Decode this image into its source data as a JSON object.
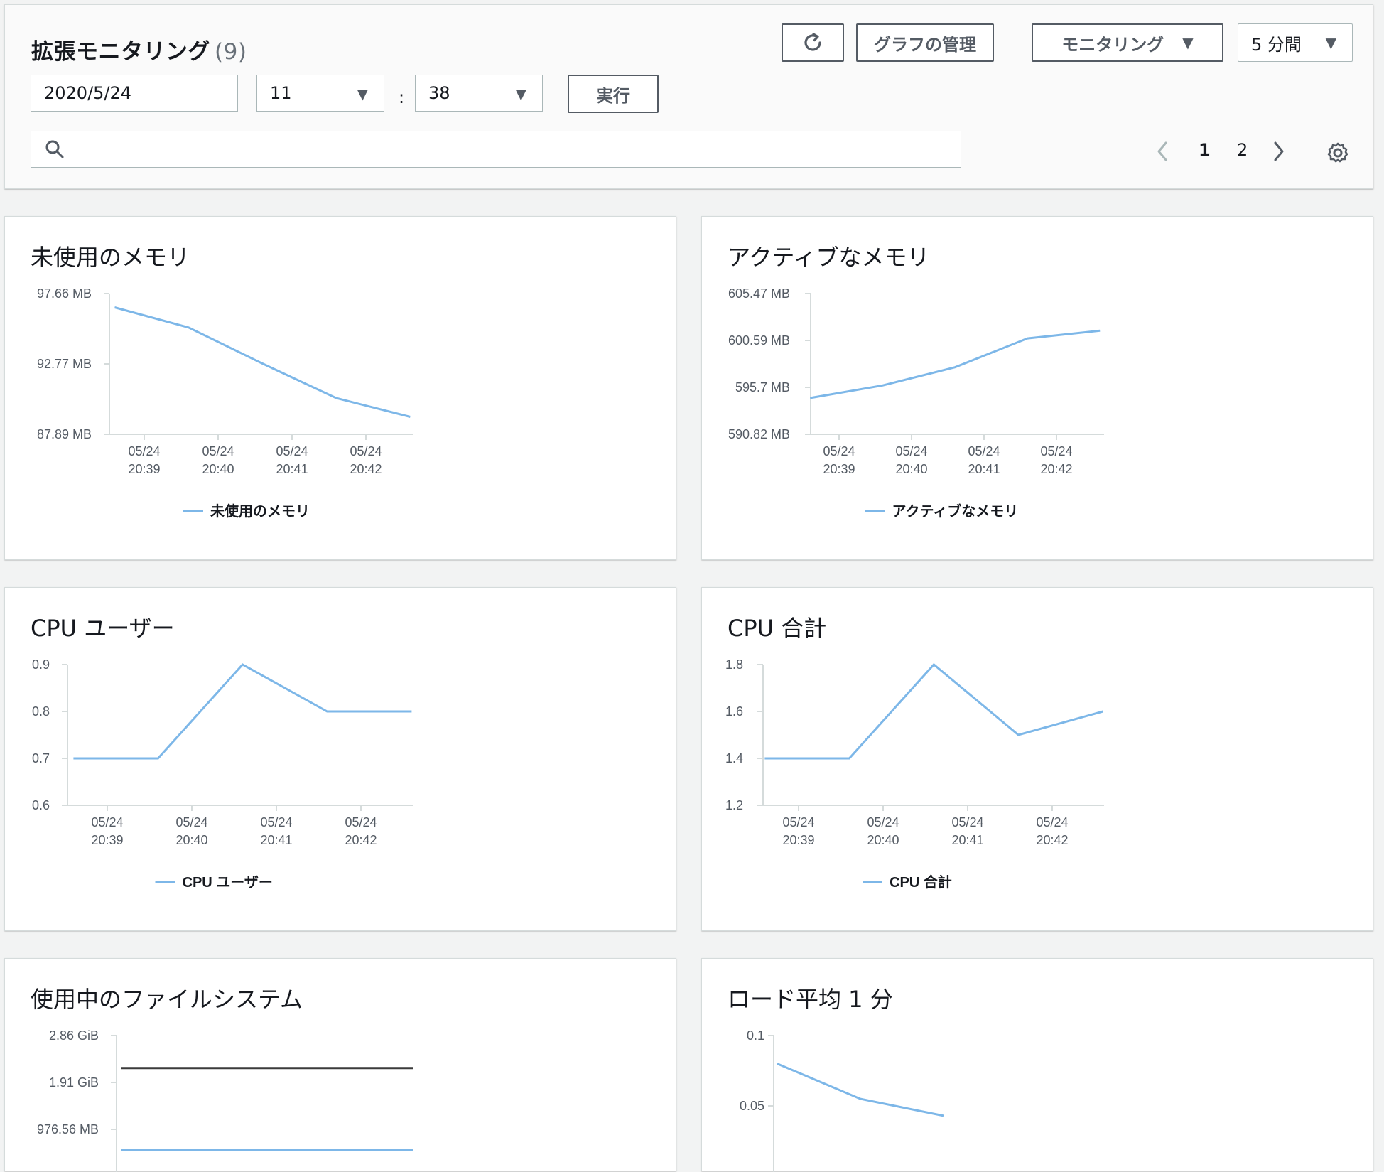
{
  "header": {
    "title": "拡張モニタリング",
    "count": "(9)",
    "refresh_icon": "refresh-icon",
    "manage_label": "グラフの管理",
    "monitoring_label": "モニタリング",
    "period_label": "5 分間",
    "date_value": "2020/5/24",
    "hour_value": "11",
    "colon": ":",
    "minute_value": "38",
    "run_label": "実行",
    "search_placeholder": "",
    "search_icon": "search-icon",
    "pager": {
      "page1": "1",
      "page2": "2"
    },
    "settings_icon": "gear-icon"
  },
  "colors": {
    "series": "#7db7e8",
    "series_dark": "#3b3b3b"
  },
  "charts": [
    {
      "title": "未使用のメモリ",
      "legend": "未使用のメモリ",
      "chart_data": {
        "type": "line",
        "x": [
          "05/24 20:39",
          "05/24 20:40",
          "05/24 20:41",
          "05/24 20:42"
        ],
        "x_labels_date": [
          "05/24",
          "05/24",
          "05/24",
          "05/24"
        ],
        "x_labels_time": [
          "20:39",
          "20:40",
          "20:41",
          "20:42"
        ],
        "y_ticks": [
          "97.66 MB",
          "92.77 MB",
          "87.89 MB"
        ],
        "ylim": [
          87.89,
          97.66
        ],
        "series": [
          {
            "name": "未使用のメモリ",
            "points": [
              [
                -0.4,
                96.7
              ],
              [
                0.6,
                95.3
              ],
              [
                1.6,
                92.8
              ],
              [
                2.6,
                90.4
              ],
              [
                3.6,
                89.1
              ]
            ]
          }
        ]
      }
    },
    {
      "title": "アクティブなメモリ",
      "legend": "アクティブなメモリ",
      "chart_data": {
        "type": "line",
        "x": [
          "05/24 20:39",
          "05/24 20:40",
          "05/24 20:41",
          "05/24 20:42"
        ],
        "x_labels_date": [
          "05/24",
          "05/24",
          "05/24",
          "05/24"
        ],
        "x_labels_time": [
          "20:39",
          "20:40",
          "20:41",
          "20:42"
        ],
        "y_ticks": [
          "605.47 MB",
          "600.59 MB",
          "595.7 MB",
          "590.82 MB"
        ],
        "ylim": [
          590.82,
          605.47
        ],
        "series": [
          {
            "name": "アクティブなメモリ",
            "points": [
              [
                -0.4,
                594.6
              ],
              [
                0.6,
                595.9
              ],
              [
                1.6,
                597.8
              ],
              [
                2.6,
                600.8
              ],
              [
                3.6,
                601.6
              ]
            ]
          }
        ]
      }
    },
    {
      "title": "CPU ユーザー",
      "legend": "CPU ユーザー",
      "chart_data": {
        "type": "line",
        "x": [
          "05/24 20:39",
          "05/24 20:40",
          "05/24 20:41",
          "05/24 20:42"
        ],
        "x_labels_date": [
          "05/24",
          "05/24",
          "05/24",
          "05/24"
        ],
        "x_labels_time": [
          "20:39",
          "20:40",
          "20:41",
          "20:42"
        ],
        "y_ticks": [
          "0.9",
          "0.8",
          "0.7",
          "0.6"
        ],
        "ylim": [
          0.6,
          0.9
        ],
        "series": [
          {
            "name": "CPU ユーザー",
            "points": [
              [
                -0.4,
                0.7
              ],
              [
                0.6,
                0.7
              ],
              [
                1.6,
                0.9
              ],
              [
                2.6,
                0.8
              ],
              [
                3.6,
                0.8
              ]
            ]
          }
        ]
      }
    },
    {
      "title": "CPU 合計",
      "legend": "CPU 合計",
      "chart_data": {
        "type": "line",
        "x": [
          "05/24 20:39",
          "05/24 20:40",
          "05/24 20:41",
          "05/24 20:42"
        ],
        "x_labels_date": [
          "05/24",
          "05/24",
          "05/24",
          "05/24"
        ],
        "x_labels_time": [
          "20:39",
          "20:40",
          "20:41",
          "20:42"
        ],
        "y_ticks": [
          "1.8",
          "1.6",
          "1.4",
          "1.2"
        ],
        "ylim": [
          1.2,
          1.8
        ],
        "series": [
          {
            "name": "CPU 合計",
            "points": [
              [
                -0.4,
                1.4
              ],
              [
                0.6,
                1.4
              ],
              [
                1.6,
                1.8
              ],
              [
                2.6,
                1.5
              ],
              [
                3.6,
                1.6
              ]
            ]
          }
        ]
      }
    },
    {
      "title": "使用中のファイルシステム",
      "legend": "",
      "chart_data": {
        "type": "line",
        "y_ticks": [
          "2.86 GiB",
          "1.91 GiB",
          "976.56 MB"
        ],
        "series": [
          {
            "name": "",
            "color": "dark",
            "level": 2.2
          },
          {
            "name": "",
            "color": "series",
            "level": 0.53
          }
        ]
      }
    },
    {
      "title": "ロード平均 1 分",
      "legend": "",
      "chart_data": {
        "type": "line",
        "y_ticks": [
          "0.1",
          "0.05"
        ],
        "series": [
          {
            "name": "",
            "points": [
              [
                0,
                0.08
              ],
              [
                1,
                0.055
              ],
              [
                2,
                0.043
              ]
            ]
          }
        ]
      }
    }
  ]
}
